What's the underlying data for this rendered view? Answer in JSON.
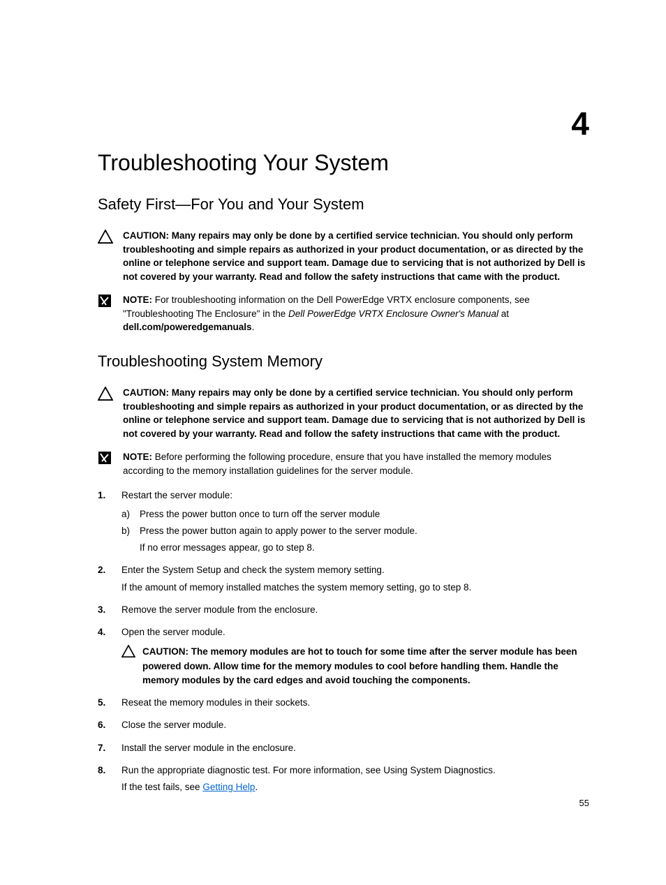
{
  "chapter_number": "4",
  "title": "Troubleshooting Your System",
  "section1": {
    "heading": "Safety First—For You and Your System",
    "caution_lead": "CAUTION: ",
    "caution_text": "Many repairs may only be done by a certified service technician. You should only perform troubleshooting and simple repairs as authorized in your product documentation, or as directed by the online or telephone service and support team. Damage due to servicing that is not authorized by Dell is not covered by your warranty. Read and follow the safety instructions that came with the product.",
    "note_lead": "NOTE: ",
    "note_pre": "For troubleshooting information on the Dell PowerEdge VRTX enclosure components, see \"Troubleshooting The Enclosure\" in the ",
    "note_em": "Dell PowerEdge VRTX Enclosure Owner's Manual",
    "note_mid": " at ",
    "note_url": "dell.com/poweredgemanuals",
    "note_post": "."
  },
  "section2": {
    "heading": "Troubleshooting System Memory",
    "caution_lead": "CAUTION: ",
    "caution_text": "Many repairs may only be done by a certified service technician. You should only perform troubleshooting and simple repairs as authorized in your product documentation, or as directed by the online or telephone service and support team. Damage due to servicing that is not authorized by Dell is not covered by your warranty. Read and follow the safety instructions that came with the product.",
    "note_lead": "NOTE: ",
    "note_text": "Before performing the following procedure, ensure that you have installed the memory modules according to the memory installation guidelines for the server module.",
    "steps": {
      "s1": "Restart the server module:",
      "s1a": "Press the power button once to turn off the server module",
      "s1b": "Press the power button again to apply power to the server module.",
      "s1note": "If no error messages appear, go to step 8.",
      "s2": "Enter the System Setup and check the system memory setting.",
      "s2b": "If the amount of memory installed matches the system memory setting, go to step 8.",
      "s3": "Remove the server module from the enclosure.",
      "s4": "Open the server module.",
      "s4caution_lead": "CAUTION: ",
      "s4caution": "The memory modules are hot to touch for some time after the server module has been powered down. Allow time for the memory modules to cool before handling them. Handle the memory modules by the card edges and avoid touching the components.",
      "s5": "Reseat the memory modules in their sockets.",
      "s6": "Close the server module.",
      "s7": "Install the server module in the enclosure.",
      "s8a": "Run the appropriate diagnostic test. For more information, see Using System Diagnostics.",
      "s8b_pre": "If the test fails, see ",
      "s8b_link": "Getting Help",
      "s8b_post": "."
    }
  },
  "page_number": "55"
}
